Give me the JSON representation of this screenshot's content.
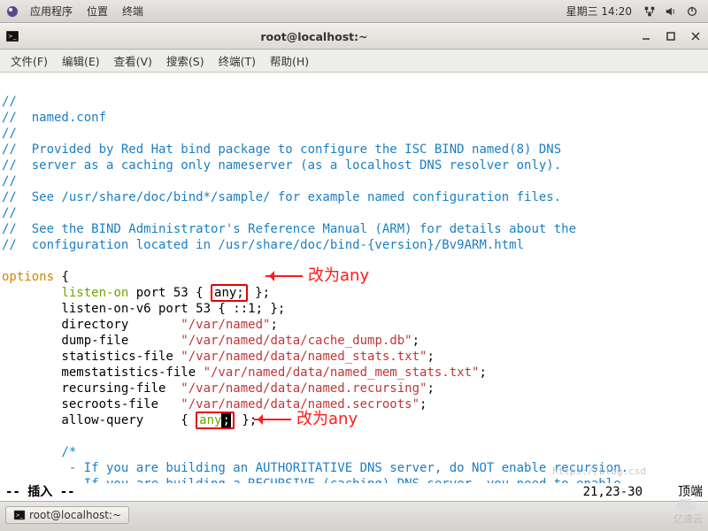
{
  "panel": {
    "menus": [
      "应用程序",
      "位置",
      "终端"
    ],
    "clock": "星期三  14:20"
  },
  "window": {
    "title": "root@localhost:~"
  },
  "menubar": {
    "items": [
      "文件(F)",
      "编辑(E)",
      "查看(V)",
      "搜索(S)",
      "终端(T)",
      "帮助(H)"
    ]
  },
  "editor": {
    "comments": {
      "l1": "//",
      "l2": "//  named.conf",
      "l3": "//",
      "l4": "//  Provided by Red Hat bind package to configure the ISC BIND named(8) DNS",
      "l5": "//  server as a caching only nameserver (as a localhost DNS resolver only).",
      "l6": "//",
      "l7": "//  See /usr/share/doc/bind*/sample/ for example named configuration files.",
      "l8": "//",
      "l9": "//  See the BIND Administrator's Reference Manual (ARM) for details about the",
      "l10": "//  configuration located in /usr/share/doc/bind-{version}/Bv9ARM.html"
    },
    "options_kw": "options",
    "brace_open": " {",
    "listen_on": {
      "key": "listen-on",
      "rest_a": " port 53 { ",
      "any": "any;",
      "rest_b": " };"
    },
    "listen_on_v6": "        listen-on-v6 port 53 { ::1; };",
    "directory": {
      "key": "        directory       ",
      "val": "\"/var/named\"",
      "end": ";"
    },
    "dump_file": {
      "key": "        dump-file       ",
      "val": "\"/var/named/data/cache_dump.db\"",
      "end": ";"
    },
    "stats_file": {
      "key": "        statistics-file ",
      "val": "\"/var/named/data/named_stats.txt\"",
      "end": ";"
    },
    "memstats_file": {
      "key": "        memstatistics-file ",
      "val": "\"/var/named/data/named_mem_stats.txt\"",
      "end": ";"
    },
    "recursing_file": {
      "key": "        recursing-file  ",
      "val": "\"/var/named/data/named.recursing\"",
      "end": ";"
    },
    "secroots_file": {
      "key": "        secroots-file   ",
      "val": "\"/var/named/data/named.secroots\"",
      "end": ";"
    },
    "allow_query": {
      "key": "        allow-query     { ",
      "any": "any",
      "semi": ";",
      "end": " };"
    },
    "tail": {
      "t1": "        /*",
      "t2": "         - If you are building an AUTHORITATIVE DNS server, do NOT enable recursion.",
      "t3": "         - If you are building a RECURSIVE (caching) DNS server, you need to enable"
    }
  },
  "annotations": {
    "a1": "改为any",
    "a2": "改为any"
  },
  "status": {
    "mode": "-- 插入 --",
    "pos": "21,23-30",
    "where": "顶端"
  },
  "taskbar": {
    "item": "root@localhost:~"
  },
  "watermark": {
    "blog": "https://blog.csd",
    "brand": "亿速云"
  }
}
